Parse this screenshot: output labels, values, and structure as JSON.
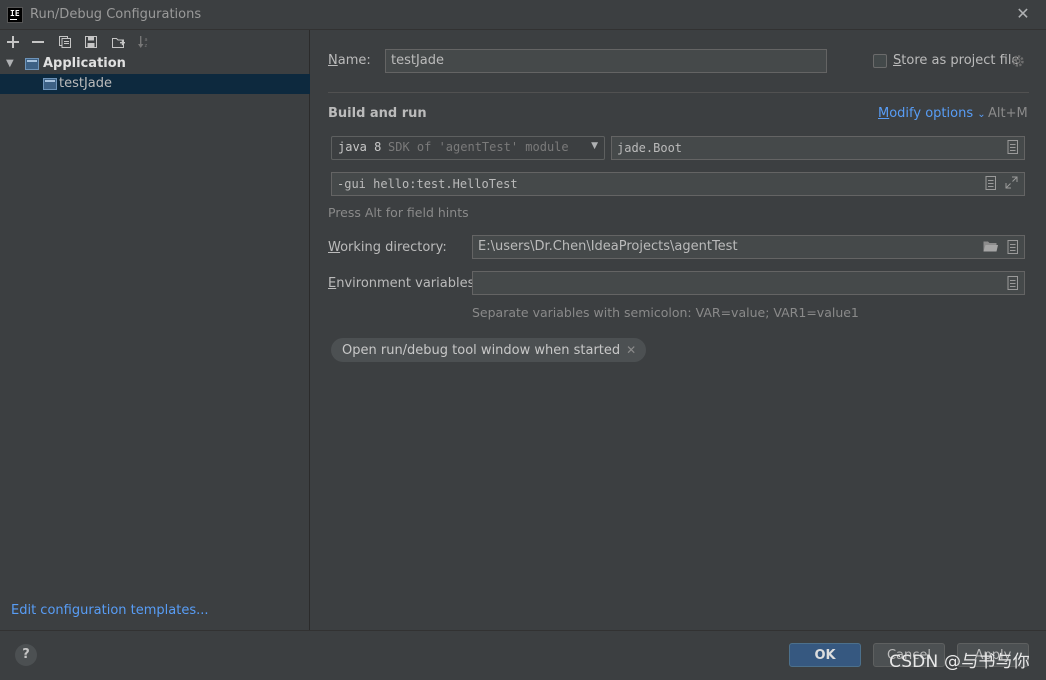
{
  "window": {
    "title": "Run/Debug Configurations",
    "app_icon_text": "IE"
  },
  "tree": {
    "group": "Application",
    "items": [
      {
        "label": "testJade"
      }
    ]
  },
  "left": {
    "edit_templates": "Edit configuration templates..."
  },
  "form": {
    "name_label_accel": "N",
    "name_label_rest": "ame:",
    "name_value": "testJade",
    "store_label_accel": "S",
    "store_label_rest": "tore as project file",
    "store_checked": false,
    "section_title": "Build and run",
    "modify_options_accel": "M",
    "modify_options_rest": "odify options",
    "modify_shortcut": "Alt+M",
    "sdk_java": "java 8",
    "sdk_desc": "SDK of 'agentTest' module",
    "main_class": "jade.Boot",
    "program_args": "-gui hello:test.HelloTest",
    "field_hint": "Press Alt for field hints",
    "workdir_label_accel": "W",
    "workdir_label_rest": "orking directory:",
    "workdir_value": "E:\\users\\Dr.Chen\\IdeaProjects\\agentTest",
    "env_label_accel": "E",
    "env_label_rest": "nvironment variables:",
    "env_value": "",
    "env_hint": "Separate variables with semicolon: VAR=value; VAR1=value1",
    "chip_label": "Open run/debug tool window when started"
  },
  "buttons": {
    "ok": "OK",
    "cancel": "Cancel",
    "apply": "Apply",
    "help": "?"
  },
  "watermark": "CSDN @与书与你"
}
